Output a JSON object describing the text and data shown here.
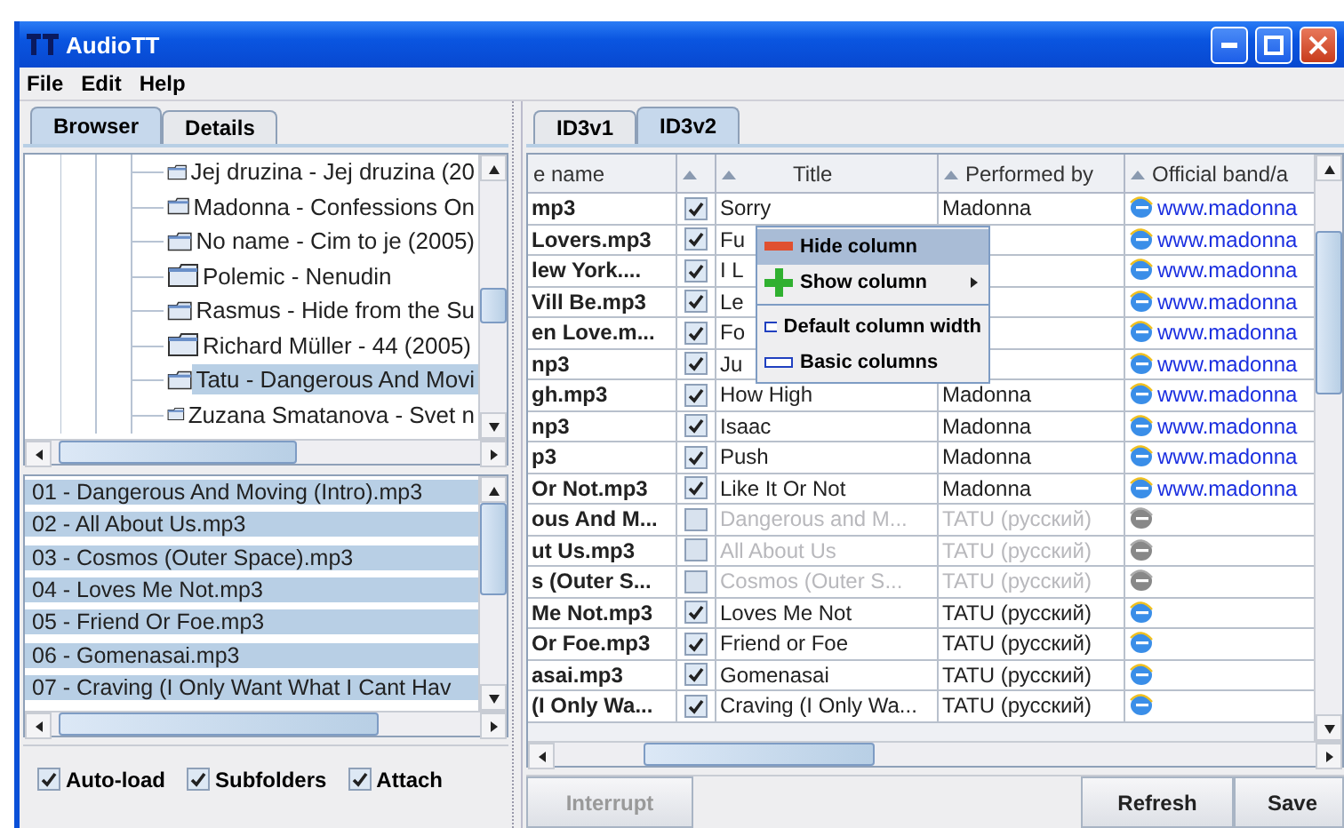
{
  "window": {
    "title": "AudioTT"
  },
  "menu": [
    "File",
    "Edit",
    "Help"
  ],
  "left_tabs": [
    {
      "label": "Browser",
      "selected": true
    },
    {
      "label": "Details",
      "selected": false
    }
  ],
  "tree": [
    {
      "label": "Jej druzina - Jej druzina (20",
      "selected": false
    },
    {
      "label": "Madonna - Confessions On",
      "selected": false
    },
    {
      "label": "No name - Cim to je (2005)",
      "selected": false
    },
    {
      "label": "Polemic - Nenudin",
      "selected": false
    },
    {
      "label": "Rasmus - Hide from the Su",
      "selected": false
    },
    {
      "label": "Richard Müller - 44 (2005)",
      "selected": false
    },
    {
      "label": "Tatu - Dangerous And Movi",
      "selected": true
    },
    {
      "label": "Zuzana Smatanova - Svet n",
      "selected": false
    }
  ],
  "files": [
    {
      "label": "01 - Dangerous And Moving (Intro).mp3",
      "selected": true
    },
    {
      "label": "02 - All About Us.mp3",
      "selected": true
    },
    {
      "label": "03 - Cosmos (Outer Space).mp3",
      "selected": true
    },
    {
      "label": "04 - Loves Me Not.mp3",
      "selected": true
    },
    {
      "label": "05 - Friend Or Foe.mp3",
      "selected": true
    },
    {
      "label": "06 - Gomenasai.mp3",
      "selected": true
    },
    {
      "label": "07 - Craving (I Only Want What I Cant Hav",
      "selected": true
    }
  ],
  "options": [
    {
      "label": "Auto-load",
      "checked": true
    },
    {
      "label": "Subfolders",
      "checked": true
    },
    {
      "label": "Attach",
      "checked": true
    }
  ],
  "right_tabs": [
    {
      "label": "ID3v1",
      "selected": false
    },
    {
      "label": "ID3v2",
      "selected": true
    }
  ],
  "table": {
    "columns": [
      {
        "label": "e name",
        "sort_arrow": false
      },
      {
        "sort_arrow": true
      },
      {
        "label": "Title",
        "sort_arrow": true
      },
      {
        "label": "Performed by",
        "sort_arrow": true
      },
      {
        "label": "Official band/a",
        "sort_arrow": true
      }
    ],
    "rows": [
      {
        "file": "mp3",
        "checked": true,
        "title": "Sorry",
        "performer": "Madonna",
        "website": "www.madonna"
      },
      {
        "file": "Lovers.mp3",
        "checked": true,
        "title": "Fu",
        "website": "www.madonna"
      },
      {
        "file": "lew York....",
        "checked": true,
        "title": "I L",
        "website": "www.madonna"
      },
      {
        "file": "Vill Be.mp3",
        "checked": true,
        "title": "Le",
        "website": "www.madonna"
      },
      {
        "file": "en Love.m...",
        "checked": true,
        "title": "Fo",
        "website": "www.madonna"
      },
      {
        "file": "np3",
        "checked": true,
        "title": "Ju",
        "website": "www.madonna"
      },
      {
        "file": "gh.mp3",
        "checked": true,
        "title": "How High",
        "performer": "Madonna",
        "website": "www.madonna"
      },
      {
        "file": "np3",
        "checked": true,
        "title": "Isaac",
        "performer": "Madonna",
        "website": "www.madonna"
      },
      {
        "file": "p3",
        "checked": true,
        "title": "Push",
        "performer": "Madonna",
        "website": "www.madonna"
      },
      {
        "file": "Or Not.mp3",
        "checked": true,
        "title": "Like It Or Not",
        "performer": "Madonna",
        "website": "www.madonna"
      },
      {
        "file": "ous And M...",
        "checked": false,
        "title": "Dangerous and M...",
        "performer": "TATU (русский)"
      },
      {
        "file": "ut Us.mp3",
        "checked": false,
        "title": "All About Us",
        "performer": "TATU (русский)"
      },
      {
        "file": "s (Outer S...",
        "checked": false,
        "title": "Cosmos (Outer S...",
        "performer": "TATU (русский)"
      },
      {
        "file": "Me Not.mp3",
        "checked": true,
        "title": "Loves Me Not",
        "performer": "TATU (русский)"
      },
      {
        "file": "Or Foe.mp3",
        "checked": true,
        "title": "Friend or Foe",
        "performer": "TATU (русский)"
      },
      {
        "file": "asai.mp3",
        "checked": true,
        "title": "Gomenasai",
        "performer": "TATU (русский)"
      },
      {
        "file": " (I Only Wa...",
        "checked": true,
        "title": "Craving (I Only Wa...",
        "performer": "TATU (русский)"
      }
    ]
  },
  "context_menu": [
    {
      "kind": "hide",
      "label": "Hide column",
      "selected": true,
      "submenu": false
    },
    {
      "kind": "show",
      "label": "Show column",
      "selected": false,
      "submenu": true
    },
    {
      "kind": "separator"
    },
    {
      "kind": "width",
      "label": "Default column width",
      "selected": false,
      "submenu": false
    },
    {
      "kind": "width",
      "label": "Basic columns",
      "selected": false,
      "submenu": false
    }
  ],
  "buttons": [
    {
      "label": "Interrupt",
      "disabled": true
    },
    {
      "label": "Refresh",
      "disabled": false
    },
    {
      "label": "Save",
      "disabled": false
    }
  ]
}
